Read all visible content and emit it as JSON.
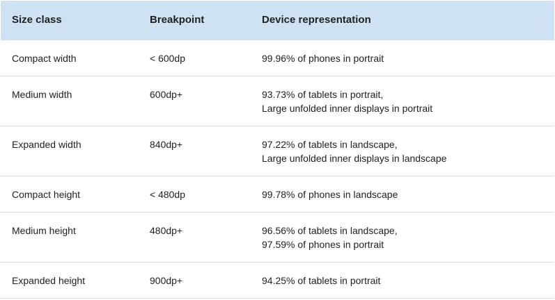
{
  "table": {
    "headers": [
      "Size class",
      "Breakpoint",
      "Device representation"
    ],
    "rows": [
      {
        "size_class": "Compact width",
        "breakpoint": "< 600dp",
        "device": [
          "99.96% of phones in portrait"
        ]
      },
      {
        "size_class": "Medium width",
        "breakpoint": "600dp+",
        "device": [
          "93.73% of tablets in portrait,",
          "Large unfolded inner displays in portrait"
        ]
      },
      {
        "size_class": "Expanded width",
        "breakpoint": "840dp+",
        "device": [
          "97.22% of tablets in landscape,",
          "Large unfolded inner displays in landscape"
        ]
      },
      {
        "size_class": "Compact height",
        "breakpoint": "< 480dp",
        "device": [
          "99.78% of phones in landscape"
        ]
      },
      {
        "size_class": "Medium height",
        "breakpoint": "480dp+",
        "device": [
          "96.56% of tablets in landscape,",
          "97.59% of phones in portrait"
        ]
      },
      {
        "size_class": "Expanded height",
        "breakpoint": "900dp+",
        "device": [
          "94.25% of tablets in portrait"
        ]
      }
    ]
  },
  "colors": {
    "header_bg": "#cfe2f3",
    "divider": "#dadce0",
    "text": "#202124"
  }
}
